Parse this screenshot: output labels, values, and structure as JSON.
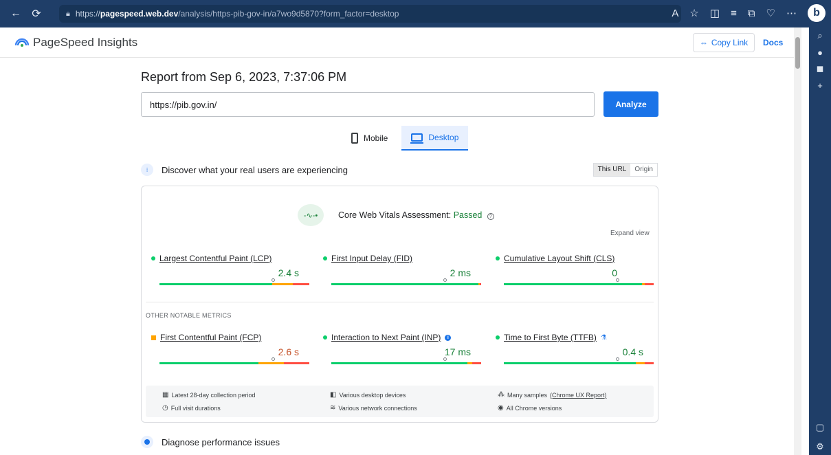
{
  "browser": {
    "url_prefix": "https://",
    "url_host": "pagespeed.web.dev",
    "url_path": "/analysis/https-pib-gov-in/a7wo9d5870?form_factor=desktop"
  },
  "header": {
    "brand": "PageSpeed Insights",
    "copy_link": "Copy Link",
    "docs": "Docs"
  },
  "report": {
    "title": "Report from Sep 6, 2023, 7:37:06 PM",
    "url_value": "https://pib.gov.in/",
    "analyze": "Analyze"
  },
  "tabs": {
    "mobile": "Mobile",
    "desktop": "Desktop"
  },
  "real_users": {
    "title": "Discover what your real users are experiencing",
    "this_url": "This URL",
    "origin": "Origin"
  },
  "cwv": {
    "assessment": "Core Web Vitals Assessment:",
    "status": "Passed",
    "expand": "Expand view"
  },
  "metrics": {
    "lcp": {
      "label": "Largest Contentful Paint (LCP)",
      "value": "2.4 s"
    },
    "fid": {
      "label": "First Input Delay (FID)",
      "value": "2 ms"
    },
    "cls": {
      "label": "Cumulative Layout Shift (CLS)",
      "value": "0"
    },
    "other_heading": "OTHER NOTABLE METRICS",
    "fcp": {
      "label": "First Contentful Paint (FCP)",
      "value": "2.6 s"
    },
    "inp": {
      "label": "Interaction to Next Paint (INP)",
      "value": "17 ms"
    },
    "ttfb": {
      "label": "Time to First Byte (TTFB)",
      "value": "0.4 s"
    }
  },
  "footer": {
    "period": "Latest 28-day collection period",
    "devices": "Various desktop devices",
    "samples": "Many samples",
    "samples_link": "(Chrome UX Report)",
    "visits": "Full visit durations",
    "network": "Various network connections",
    "chrome": "All Chrome versions"
  },
  "diagnose": {
    "title": "Diagnose performance issues"
  },
  "colors": {
    "good": "#0cce6b",
    "average": "#ffa400",
    "poor": "#ff4e42",
    "accent": "#1a73e8"
  }
}
